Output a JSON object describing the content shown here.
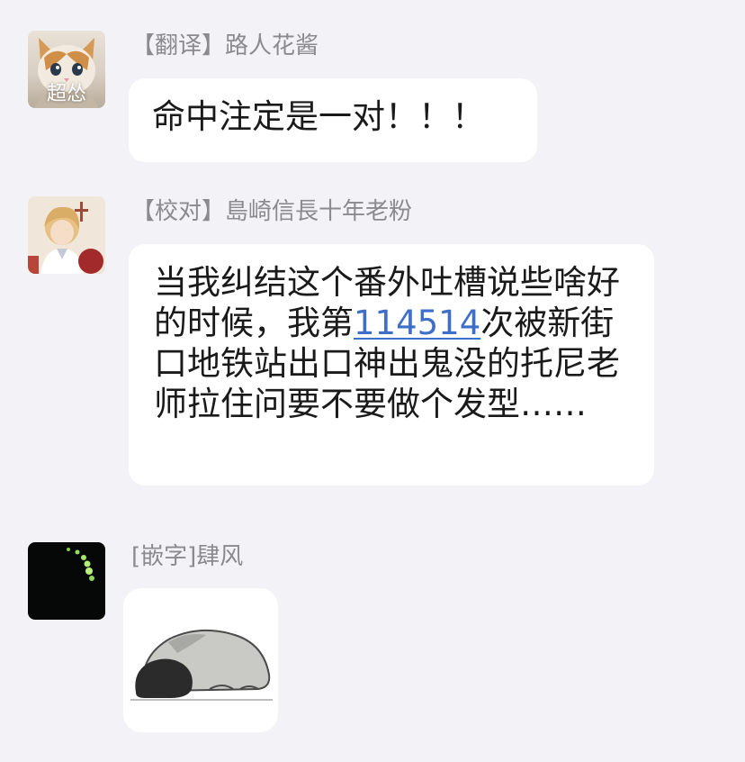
{
  "messages": [
    {
      "sender_tag": "【翻译】",
      "sender_name": "路人花酱",
      "avatar_caption": "超怂",
      "text": "命中注定是一对！！！"
    },
    {
      "sender_tag": "【校对】",
      "sender_name": "島崎信長十年老粉",
      "text_before": "当我纠结这个番外吐槽说些啥好的时候，我第",
      "link_text": "114514",
      "text_after": "次被新街口地铁站出口神出鬼没的托尼老师拉住问要不要做个发型……"
    },
    {
      "sender_tag": "[嵌字]",
      "sender_name": "肆风",
      "sticker": "sleeping-creature-sticker"
    }
  ],
  "colors": {
    "background": "#f2f2f7",
    "bubble": "#ffffff",
    "sender": "#8a8a8f",
    "link": "#3d6ec9"
  }
}
